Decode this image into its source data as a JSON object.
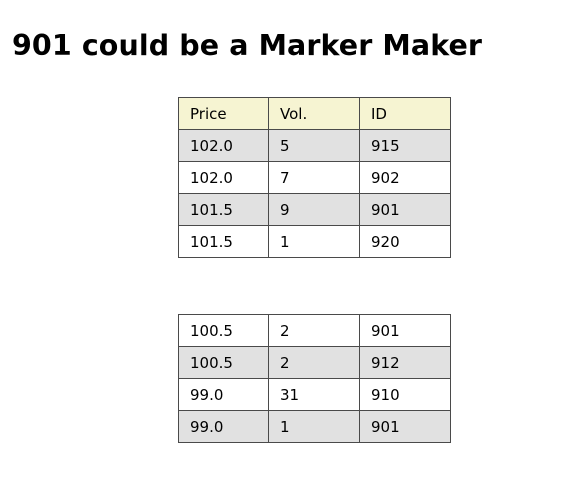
{
  "title": "901 could be a Marker Maker",
  "ask_table": {
    "headers": [
      "Price",
      "Vol.",
      "ID"
    ],
    "rows": [
      [
        "102.0",
        "5",
        "915"
      ],
      [
        "102.0",
        "7",
        "902"
      ],
      [
        "101.5",
        "9",
        "901"
      ],
      [
        "101.5",
        "1",
        "920"
      ]
    ]
  },
  "bid_table": {
    "rows": [
      [
        "100.5",
        "2",
        "901"
      ],
      [
        "100.5",
        "2",
        "912"
      ],
      [
        "99.0",
        "31",
        "910"
      ],
      [
        "99.0",
        "1",
        "901"
      ]
    ]
  },
  "colors": {
    "header_bg": "#f6f4d2",
    "shaded_row_bg": "#e1e1e1",
    "border": "#4a4a4a"
  }
}
